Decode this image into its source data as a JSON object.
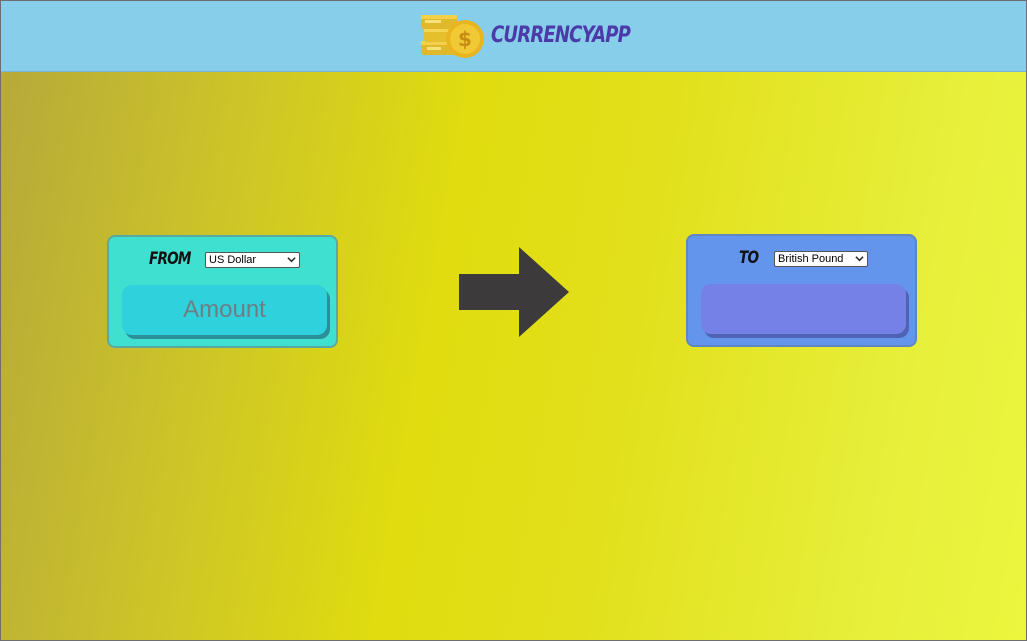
{
  "app": {
    "title": "CURRENCYAPP",
    "logo_icon": "coin-stack-icon"
  },
  "colors": {
    "header_bg": "#87ceeb",
    "title_color": "#4b3aa8",
    "from_card_bg": "#40e0d0",
    "to_card_bg": "#6495ed",
    "arrow_color": "#3c3a3a"
  },
  "converter": {
    "from": {
      "label": "FROM",
      "selected_currency": "US Dollar",
      "amount_placeholder": "Amount"
    },
    "to": {
      "label": "TO",
      "selected_currency": "British Pound",
      "result": ""
    },
    "arrow_icon": "right-arrow-icon"
  }
}
